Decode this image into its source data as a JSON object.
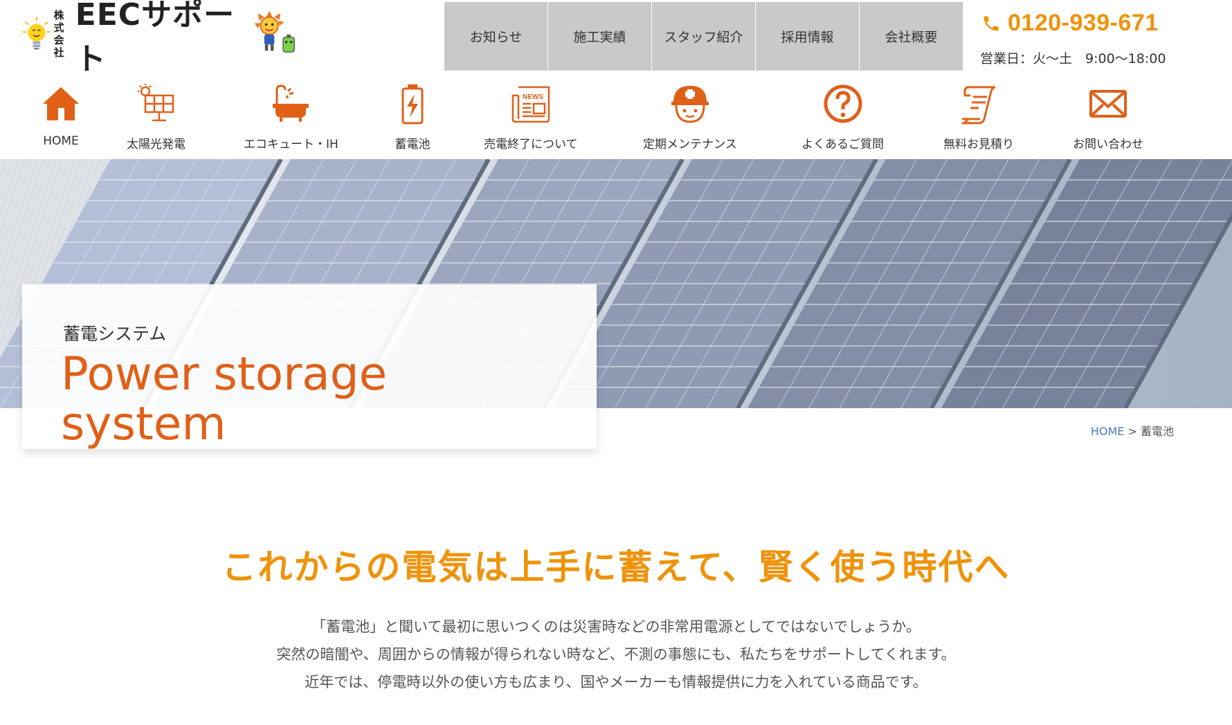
{
  "logo": {
    "corp_line1": "株式",
    "corp_line2": "会社",
    "name": "EECサポート"
  },
  "topnav": [
    {
      "label": "お知らせ"
    },
    {
      "label": "施工実績"
    },
    {
      "label": "スタッフ紹介"
    },
    {
      "label": "採用情報"
    },
    {
      "label": "会社概要"
    }
  ],
  "contact": {
    "phone": "0120-939-671",
    "hours": "営業日：火〜土　9:00〜18:00"
  },
  "iconnav": [
    {
      "label": "HOME",
      "icon": "home-icon"
    },
    {
      "label": "太陽光発電",
      "icon": "solar-panel-icon"
    },
    {
      "label": "エコキュート・IH",
      "icon": "bathtub-icon"
    },
    {
      "label": "蓄電池",
      "icon": "battery-icon"
    },
    {
      "label": "売電終了について",
      "icon": "news-icon"
    },
    {
      "label": "定期メンテナンス",
      "icon": "helmet-icon"
    },
    {
      "label": "よくあるご質問",
      "icon": "question-icon"
    },
    {
      "label": "無料お見積り",
      "icon": "document-icon"
    },
    {
      "label": "お問い合わせ",
      "icon": "mail-icon"
    }
  ],
  "hero": {
    "subtitle": "蓄電システム",
    "title": "Power storage system"
  },
  "breadcrumb": {
    "home": "HOME",
    "separator": " > ",
    "current": "蓄電池"
  },
  "content": {
    "headline": "これからの電気は上手に蓄えて、賢く使う時代へ",
    "paragraph": [
      "「蓄電池」と聞いて最初に思いつくのは災害時などの非常用電源としてではないでしょうか。",
      "突然の暗闇や、周囲からの情報が得られない時など、不測の事態にも、私たちをサポートしてくれます。",
      "近年では、停電時以外の使い方も広まり、国やメーカーも情報提供に力を入れている商品です。"
    ]
  },
  "colors": {
    "accent_orange": "#e06018",
    "phone_orange": "#f0920a",
    "nav_gray": "#c9c9c9"
  }
}
